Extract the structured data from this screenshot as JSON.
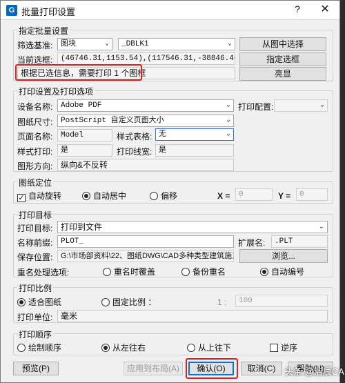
{
  "titlebar": {
    "icon_letter": "G",
    "title": "批量打印设置",
    "help_symbol": "?",
    "close_symbol": "✕"
  },
  "batch_group": {
    "label": "指定批量设置",
    "filter_label": "筛选基准:",
    "filter_value": "图块",
    "block_value": "_DBLK1",
    "pick_from_drawing": "从图中选择",
    "current_selection_label": "当前选框:",
    "current_selection_value": "(46746.31,1153.54),(117546.31,-38846.46)",
    "select_frame": "指定选框",
    "info_text": "根据已选信息，需要打印 1 个图框",
    "highlight": "亮显"
  },
  "print_settings": {
    "label": "打印设置及打印选项",
    "device_label": "设备名称:",
    "device_value": "Adobe PDF",
    "config_label": "打印配置:",
    "config_value": "",
    "paper_label": "图纸尺寸:",
    "paper_value": "PostScript 自定义页面大小",
    "page_name_label": "页面名称:",
    "page_name_value": "Model",
    "style_table_label": "样式表格:",
    "style_table_value": "无",
    "style_print_label": "样式打印:",
    "style_print_value": "是",
    "lineweight_label": "打印线宽:",
    "lineweight_value": "是",
    "orientation_label": "图形方向:",
    "orientation_value": "纵向&不反转"
  },
  "placement": {
    "label": "图纸定位",
    "auto_rotate": "自动旋转",
    "auto_center": "自动居中",
    "offset": "偏移",
    "x_label": "X =",
    "x_value": "0",
    "y_label": "Y =",
    "y_value": "0"
  },
  "target": {
    "label": "打印目标",
    "target_label": "打印目标:",
    "target_value": "打印到文件",
    "prefix_label": "名称前缀:",
    "prefix_value": "PLOT_",
    "ext_label": "扩展名:",
    "ext_value": ".PLT",
    "save_label": "保存位置:",
    "save_value": "G:\\市场部资料\\22、图纸DWG\\CAD多种类型建筑施工图",
    "browse": "浏览...",
    "rename_label": "重名处理选项:",
    "overwrite": "重名时覆盖",
    "backup": "备份重名",
    "auto_number": "自动编号"
  },
  "scale": {
    "label": "打印比例",
    "fit": "适合图纸",
    "fixed": "固定比例 ：",
    "ratio_prefix": "1 :",
    "ratio_value": "100",
    "unit_label": "打印单位:",
    "unit_value": "毫米"
  },
  "order": {
    "label": "打印顺序",
    "draw_order": "绘制顺序",
    "left_right": "从左往右",
    "top_bottom": "从上往下",
    "reverse": "逆序"
  },
  "footer": {
    "preview": "预览(P)",
    "apply_layout": "应用到布局(A)",
    "ok": "确认(O)",
    "cancel": "取消(C)",
    "help": "帮助(H)"
  },
  "watermark": "头条 @浩辰CAD",
  "colors": {
    "highlight_red": "#e02020",
    "accent_blue": "#0078d7"
  }
}
